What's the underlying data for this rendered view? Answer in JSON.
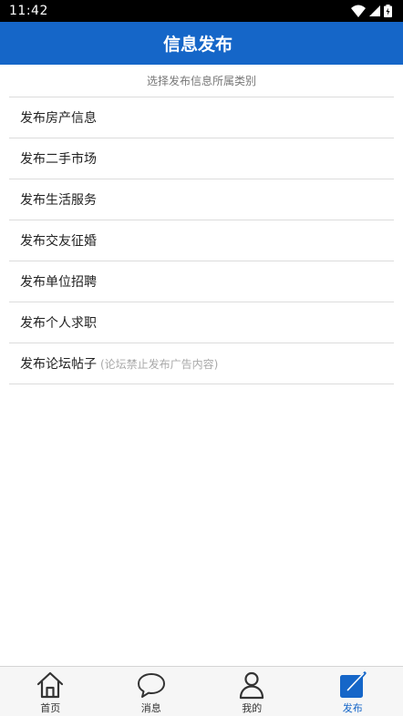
{
  "status_bar": {
    "time": "11:42",
    "icons": [
      "wifi-icon",
      "signal-icon",
      "battery-icon"
    ]
  },
  "header": {
    "title": "信息发布"
  },
  "hint": "选择发布信息所属类别",
  "categories": [
    {
      "label": "发布房产信息",
      "note": ""
    },
    {
      "label": "发布二手市场",
      "note": ""
    },
    {
      "label": "发布生活服务",
      "note": ""
    },
    {
      "label": "发布交友征婚",
      "note": ""
    },
    {
      "label": "发布单位招聘",
      "note": ""
    },
    {
      "label": "发布个人求职",
      "note": ""
    },
    {
      "label": "发布论坛帖子",
      "note": "(论坛禁止发布广告内容)"
    }
  ],
  "tabs": [
    {
      "label": "首页",
      "icon": "home-icon",
      "active": false
    },
    {
      "label": "消息",
      "icon": "chat-bubble-icon",
      "active": false
    },
    {
      "label": "我的",
      "icon": "user-icon",
      "active": false
    },
    {
      "label": "发布",
      "icon": "edit-icon",
      "active": true
    }
  ],
  "colors": {
    "header_bg": "#1566c8",
    "accent": "#1566c8",
    "divider": "#dcdcdc",
    "tab_bar_bg": "#f6f6f6"
  }
}
